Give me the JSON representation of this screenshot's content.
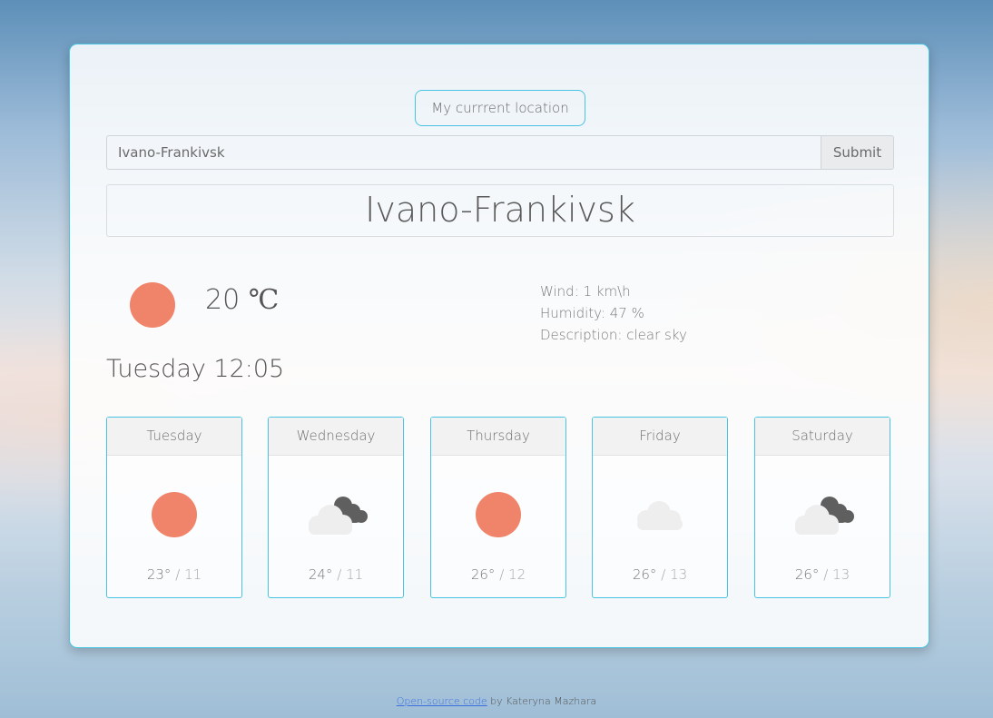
{
  "location_button": {
    "label": "My currrent location"
  },
  "search": {
    "value": "Ivano-Frankivsk",
    "submit_label": "Submit"
  },
  "city": {
    "name": "Ivano-Frankivsk"
  },
  "current": {
    "icon": "sun-icon",
    "temperature": "20",
    "unit": "℃",
    "wind": "Wind: 1 km\\h",
    "humidity": "Humidity: 47 %",
    "description": "Description: clear sky",
    "datetime": "Tuesday 12:05"
  },
  "forecast": [
    {
      "day": "Tuesday",
      "icon": "sun-icon",
      "max": "23°",
      "sep": "/",
      "min": "11"
    },
    {
      "day": "Wednesday",
      "icon": "dark-clouds-icon",
      "max": "24°",
      "sep": "/",
      "min": "11"
    },
    {
      "day": "Thursday",
      "icon": "sun-icon",
      "max": "26°",
      "sep": "/",
      "min": "12"
    },
    {
      "day": "Friday",
      "icon": "cloud-icon",
      "max": "26°",
      "sep": "/",
      "min": "13"
    },
    {
      "day": "Saturday",
      "icon": "dark-clouds-icon",
      "max": "26°",
      "sep": "/",
      "min": "13"
    }
  ],
  "footer": {
    "link_text": "Open-source code",
    "suffix": "by Kateryna Mazhara"
  },
  "colors": {
    "accent": "#48c3e1",
    "sun": "#ef846a",
    "link": "#3b6fe0"
  }
}
